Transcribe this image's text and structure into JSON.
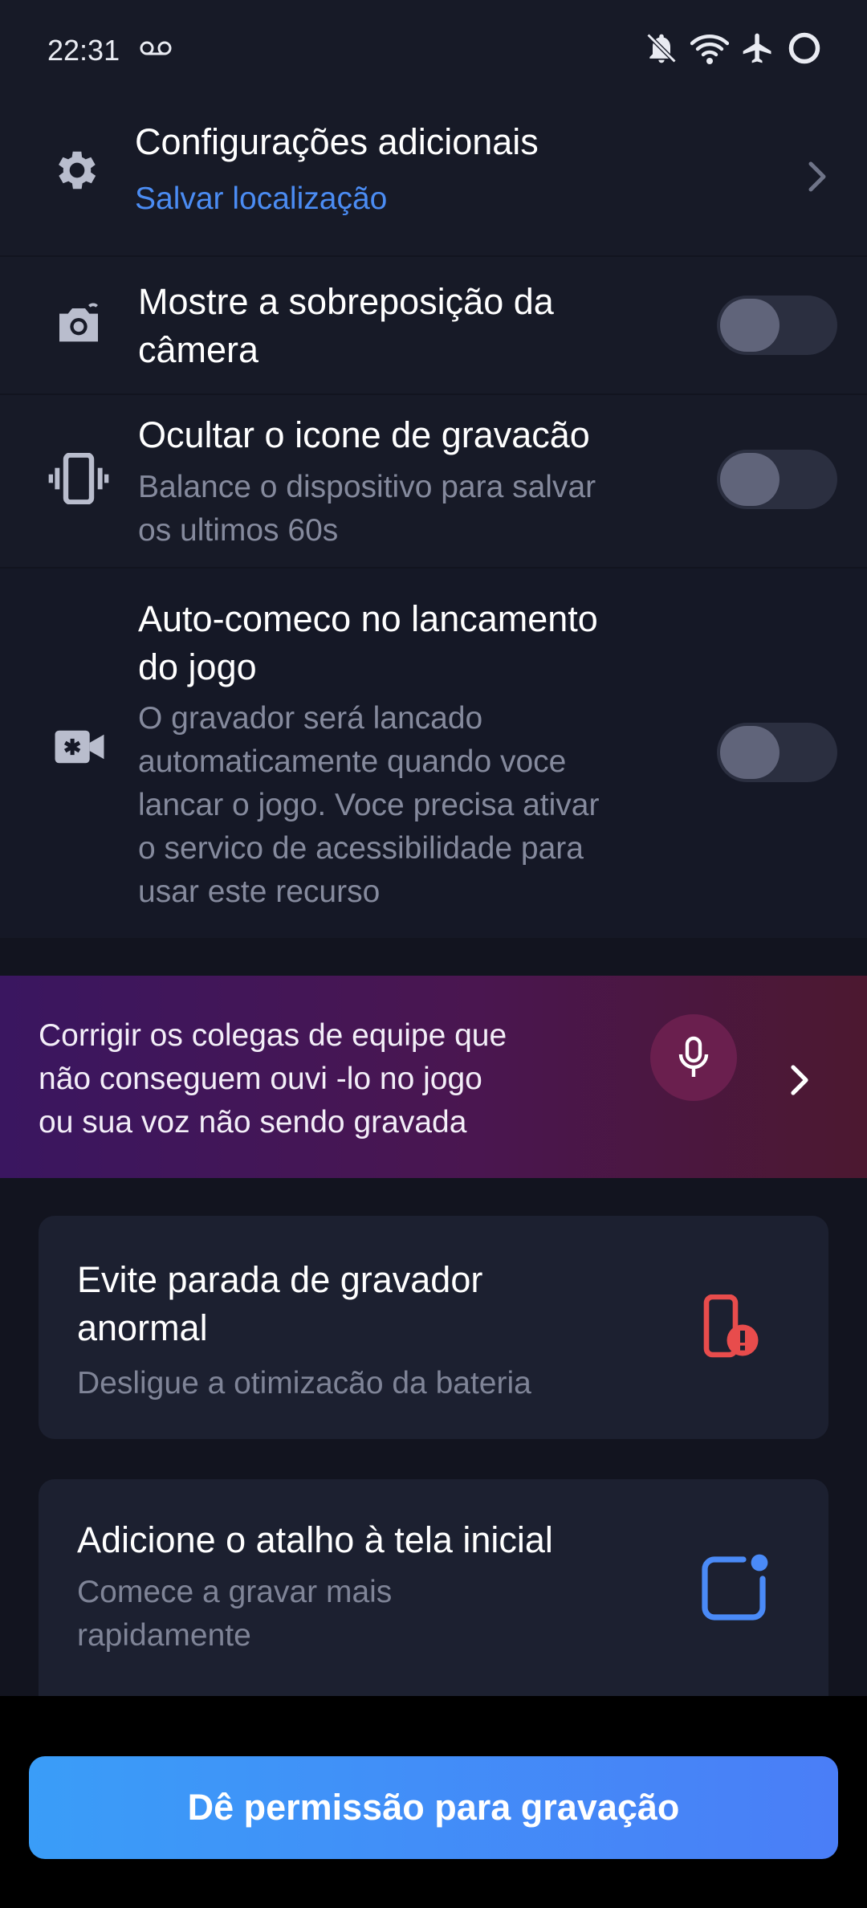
{
  "status_bar": {
    "time": "22:31",
    "icons": [
      "voicemail-icon",
      "notifications-off-icon",
      "wifi-icon",
      "airplane-mode-icon",
      "loading-ring-icon"
    ]
  },
  "settings": {
    "additional": {
      "title": "Configurações adicionais",
      "subtitle": "Salvar localização",
      "icon": "gear-icon"
    },
    "camera_overlay": {
      "title_line1": "Mostre a sobreposição da",
      "title_line2": "câmera",
      "icon": "camera-icon",
      "enabled": false
    },
    "hide_record_icon": {
      "title": "Ocultar o icone de gravacão",
      "sub_line1": "Balance o dispositivo para salvar",
      "sub_line2": "os ultimos 60s",
      "icon": "phone-shake-icon",
      "enabled": false
    },
    "auto_start": {
      "title_line1": "Auto-comeco no lancamento",
      "title_line2": "do jogo",
      "sub_lines": [
        "O gravador será lancado",
        "automaticamente quando voce",
        "lancar o jogo. Voce precisa ativar",
        "o servico de acessibilidade para",
        "usar este recurso"
      ],
      "icon": "video-camera-icon",
      "enabled": false
    }
  },
  "banner": {
    "lines": [
      "Corrigir os colegas de equipe que",
      "não conseguem ouvi -lo no jogo",
      "ou sua voz não sendo gravada"
    ],
    "icon": "microphone-icon"
  },
  "cards": {
    "battery": {
      "title_line1": "Evite parada de gravador",
      "title_line2": "anormal",
      "subtitle": "Desligue a otimizacão da bateria",
      "icon": "phone-alert-icon"
    },
    "shortcut": {
      "title": "Adicione o atalho à tela inicial",
      "sub_line1": "Comece a gravar mais",
      "sub_line2": "rapidamente",
      "icon": "shortcut-icon"
    }
  },
  "permission_button": {
    "label": "Dê permissão para gravação"
  },
  "colors": {
    "background": "#12141f",
    "accent_blue": "#4a8af7",
    "alert_red": "#e84c4c",
    "link_blue": "#4b8cf3"
  }
}
